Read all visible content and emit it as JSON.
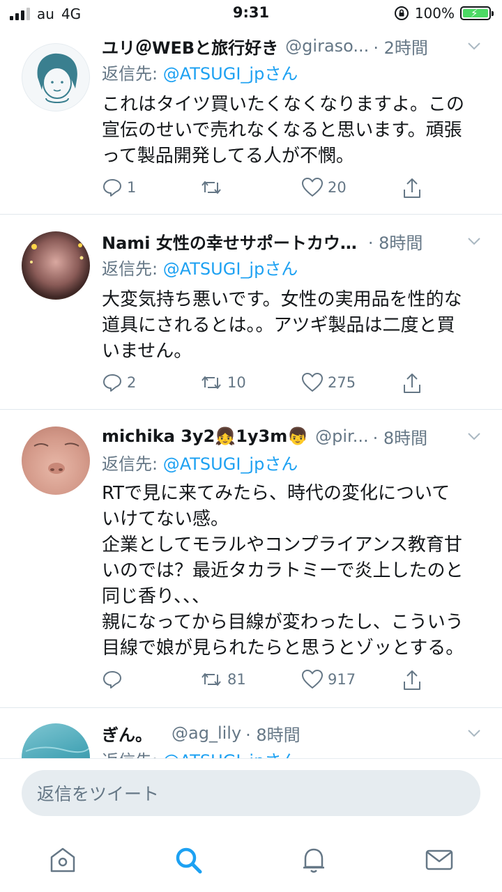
{
  "status": {
    "carrier": "au",
    "network": "4G",
    "time": "9:31",
    "battery": "100%"
  },
  "tweets": [
    {
      "display_name": "ユリ＠WEBと旅行好き",
      "handle": "@giraso...",
      "time": "· 2時間",
      "reply_prefix": "返信先: ",
      "reply_to": "@ATSUGI_jpさん",
      "text": "これはタイツ買いたくなくなりますよ。この\n宣伝のせいで売れなくなると思います。頑張\nって製品開発してる人が不憫。",
      "replies": "1",
      "retweets": "",
      "likes": "20"
    },
    {
      "display_name": "Nami 女性の幸せサポートカウ…",
      "handle": "",
      "time": "· 8時間",
      "reply_prefix": "返信先: ",
      "reply_to": "@ATSUGI_jpさん",
      "text": "大変気持ち悪いです。女性の実用品を性的な\n道具にされるとは。。アツギ製品は二度と買\nいません。",
      "replies": "2",
      "retweets": "10",
      "likes": "275"
    },
    {
      "display_name": "michika 3y2👧1y3m👦",
      "handle": "@pir...",
      "time": "· 8時間",
      "reply_prefix": "返信先: ",
      "reply_to": "@ATSUGI_jpさん",
      "text": "RTで見に来てみたら、時代の変化について\nいけてない感。\n企業としてモラルやコンプライアンス教育甘\nいのでは？最近タカラトミーで炎上したのと\n同じ香り、、、\n親になってから目線が変わったし、こういう\n目線で娘が見られたらと思うとゾッとする。",
      "replies": "",
      "retweets": "81",
      "likes": "917"
    },
    {
      "display_name": "ぎん。",
      "handle": "@ag_lily",
      "time": "· 8時間",
      "reply_prefix": "返信先: ",
      "reply_to": "@ATSUGI_jpさん",
      "text": "",
      "replies": "",
      "retweets": "",
      "likes": ""
    }
  ],
  "composer": {
    "placeholder": "返信をツイート"
  },
  "colors": {
    "accent": "#1da1f2",
    "muted": "#657786",
    "text": "#14171a"
  },
  "tabbar": {
    "items": [
      "home-icon",
      "search-icon",
      "notifications-icon",
      "messages-icon"
    ],
    "active": "search-icon"
  }
}
